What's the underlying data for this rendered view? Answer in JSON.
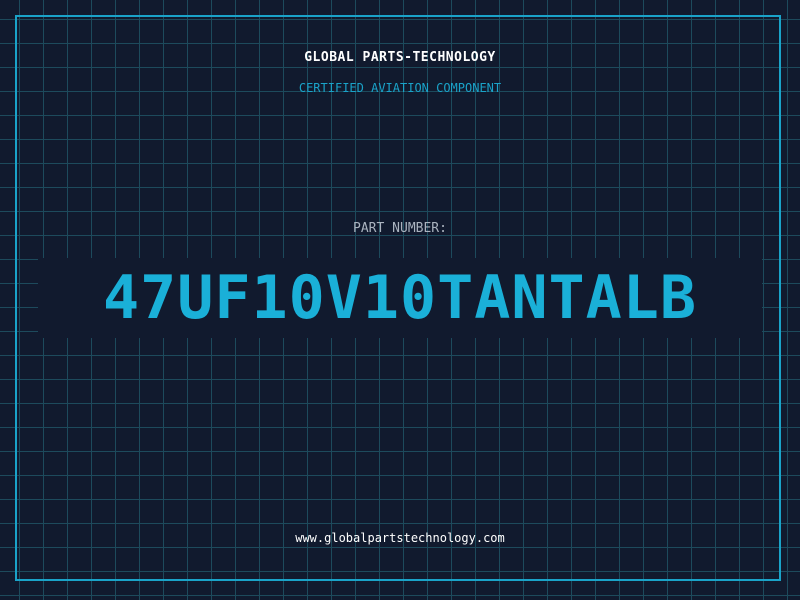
{
  "header": {
    "brand": "GLOBAL PARTS-TECHNOLOGY",
    "subtitle": "CERTIFIED AVIATION COMPONENT"
  },
  "part": {
    "label": "PART NUMBER:",
    "number": "47UF10V10TANTALB"
  },
  "footer": {
    "website": "www.globalpartstechnology.com"
  },
  "colors": {
    "background": "#111a2e",
    "grid": "#1d4a5c",
    "accent": "#1aa3c9",
    "text": "#ffffff",
    "muted": "#aab3bf"
  }
}
